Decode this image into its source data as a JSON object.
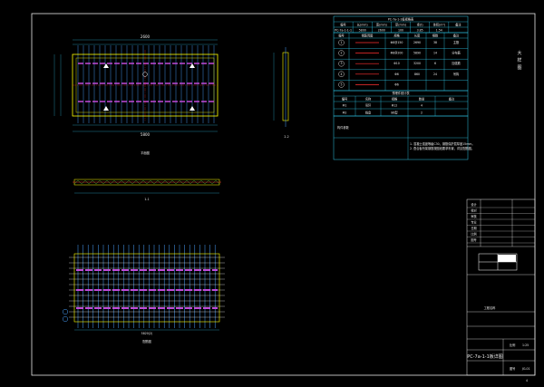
{
  "views": {
    "plan": {
      "dim_top": "2600",
      "dim_total": "5800",
      "label": "平面图"
    },
    "section_1": {
      "label": "1-1"
    },
    "section_2": {
      "label": "2-2"
    },
    "reinf_plan": {
      "dim_total": "5820(2)",
      "label": "配筋图"
    }
  },
  "header_table": {
    "title": "PC-7a-1-1板规格表",
    "headers": [
      "编号",
      "长(mm)",
      "宽(mm)",
      "厚(mm)",
      "重(t)",
      "体积(m³)",
      "备注"
    ],
    "row": [
      "PC-7a-1-1-1",
      "5800",
      "2600",
      "100",
      "3.85",
      "1.54",
      ""
    ]
  },
  "rebar_table": {
    "headers": [
      "编号",
      "钢筋简图",
      "规格",
      "长度",
      "根数",
      "备注"
    ],
    "rows": [
      {
        "id": "1",
        "spec": "Φ8@150",
        "len": "2690",
        "count": "38",
        "note": "主筋"
      },
      {
        "id": "2",
        "spec": "Φ8@200",
        "len": "5890",
        "count": "14",
        "note": "分布筋"
      },
      {
        "id": "3",
        "spec": "Φ10",
        "len": "3200",
        "count": "6",
        "note": "加强筋"
      },
      {
        "id": "4",
        "spec": "Φ6",
        "len": "860",
        "count": "24",
        "note": "吊钩"
      },
      {
        "id": "5",
        "spec": "Φ6",
        "len": "",
        "count": "",
        "note": ""
      }
    ]
  },
  "embed_table": {
    "title": "预埋件统计表",
    "headers": [
      "编号",
      "名称",
      "规格",
      "数量",
      "备注"
    ],
    "rows": [
      [
        "M1",
        "吊环",
        "Φ12",
        "4",
        ""
      ],
      [
        "M2",
        "线盒",
        "86型",
        "2",
        ""
      ]
    ]
  },
  "notes_title": "构件参数",
  "notes": [
    "1. 混凝土强度等级C30，钢筋保护层厚度15mm。",
    "2. 叠合板桁架钢筋按图纸要求布置，详见配筋图。"
  ],
  "side_marks": [
    "大",
    "样",
    "图"
  ],
  "title_block": {
    "rows": [
      "设计",
      "校对",
      "审核",
      "专业",
      "日期",
      "比例",
      "图号"
    ],
    "project": "工程名称",
    "drawing_no": "PC-7a-1-1板详图",
    "scale_label": "比例",
    "scale": "1:25",
    "sheet": "图号",
    "sheet_no": "JG-01"
  },
  "page_number": "4",
  "colors": {
    "frame": "#e8e8e8",
    "outline": "#ffff00",
    "rebar": "#4aa3ff",
    "bar_magenta": "#c04bd8",
    "table_lines": "#2ec7e8",
    "red": "#ff3030",
    "green": "#44dd44",
    "dim": "#3bd6ff"
  }
}
